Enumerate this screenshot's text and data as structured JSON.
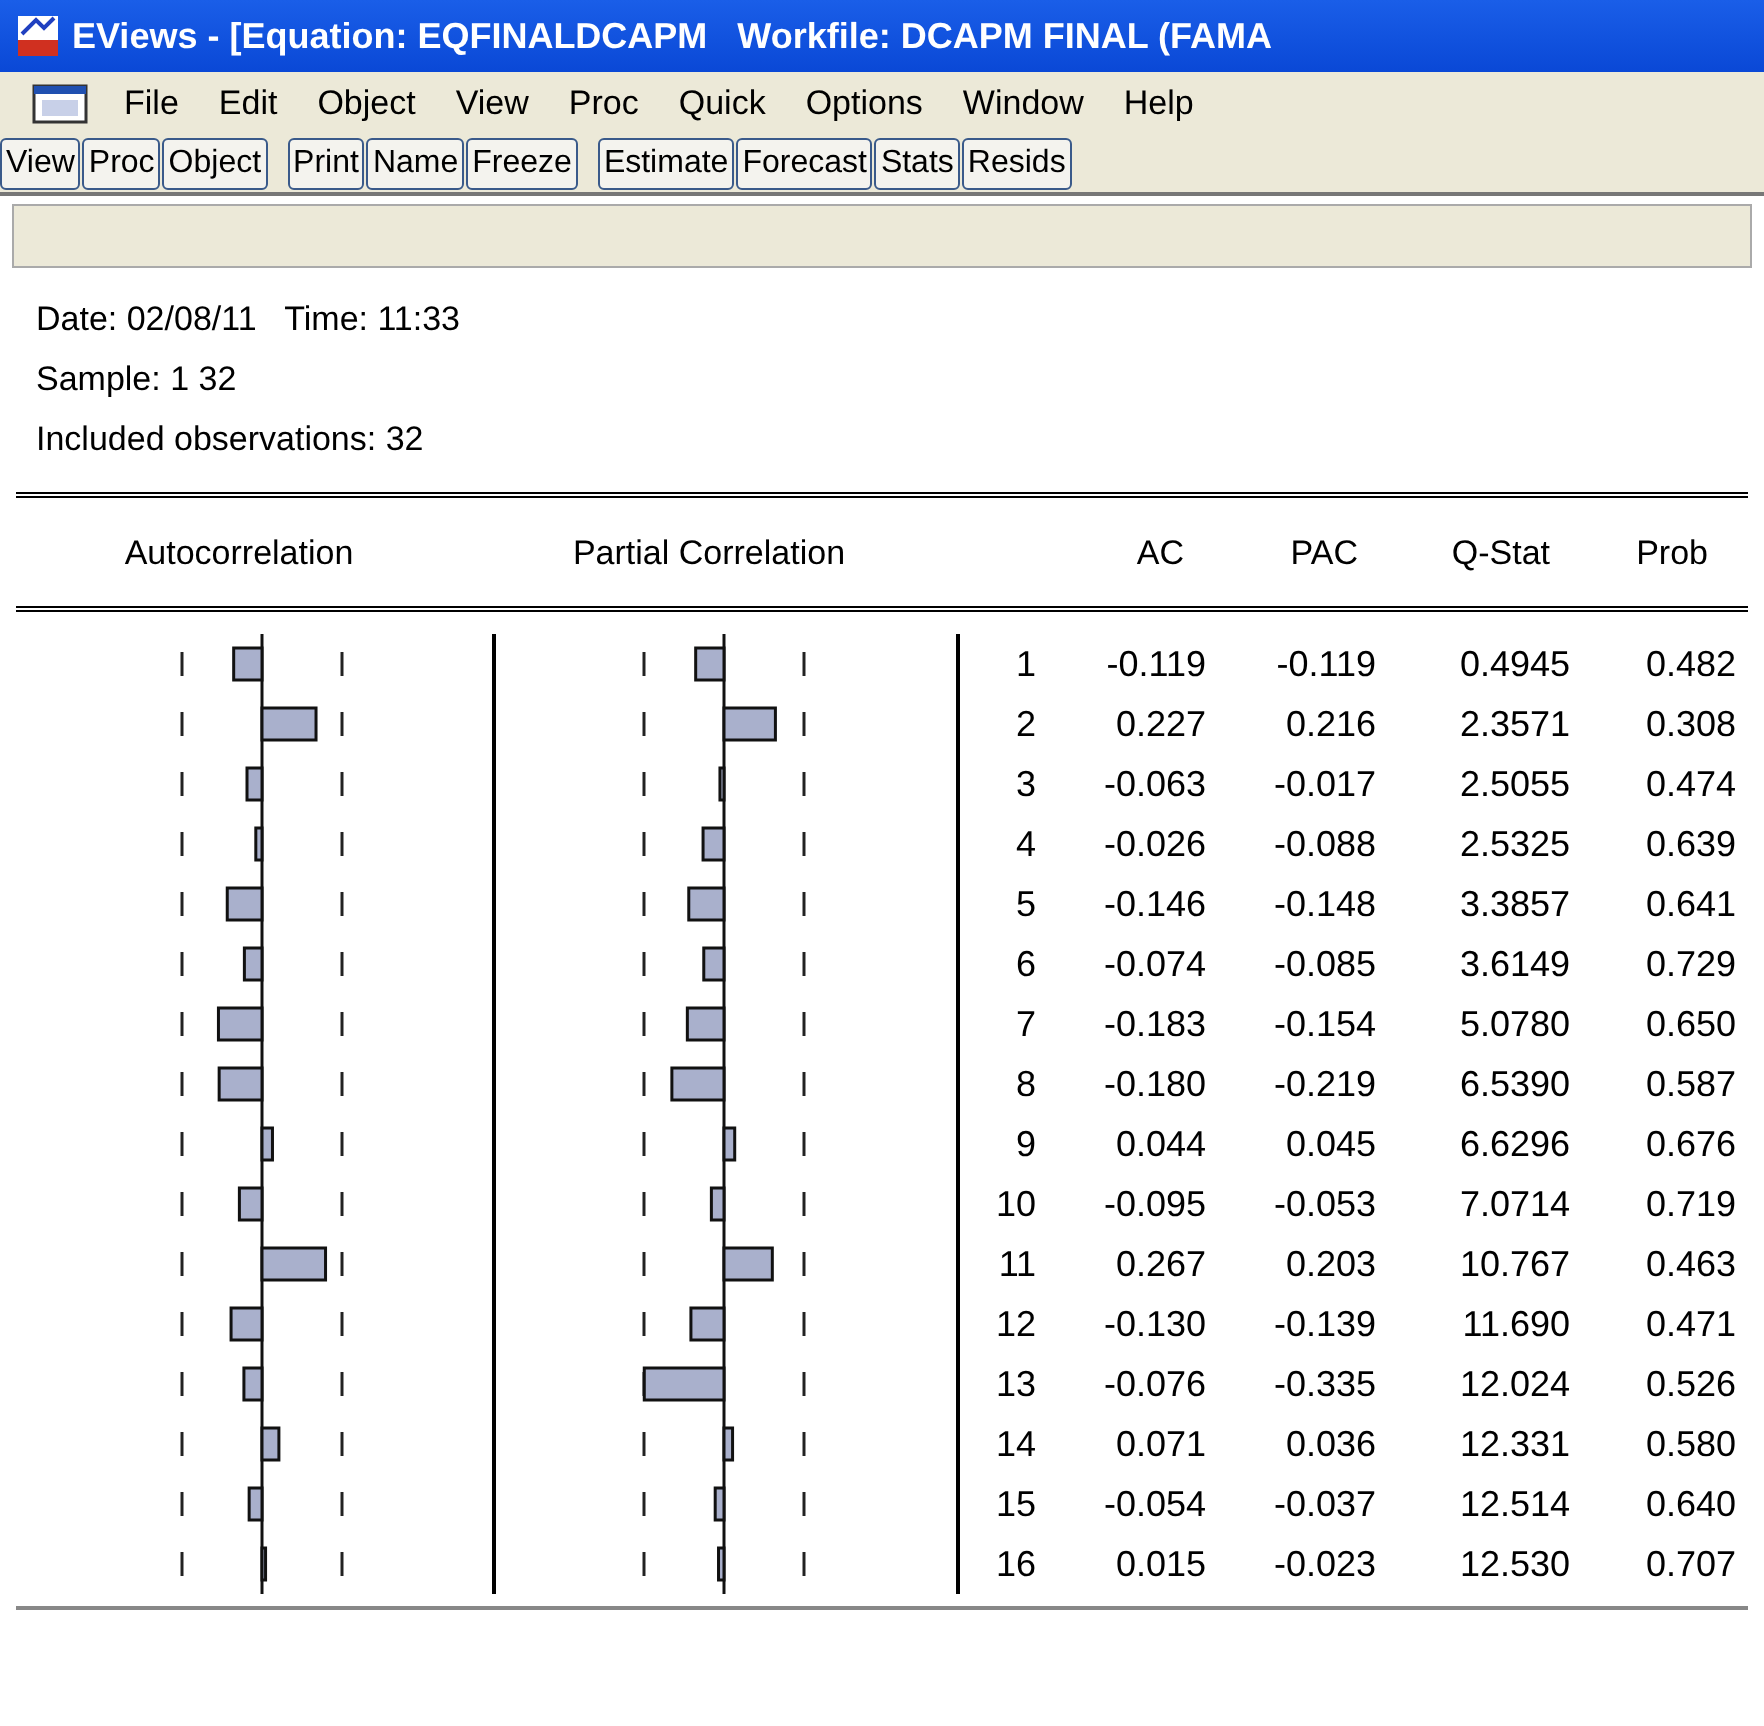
{
  "window": {
    "title": "EViews - [Equation: EQFINALDCAPM   Workfile: DCAPM FINAL (FAMA"
  },
  "menu": [
    "File",
    "Edit",
    "Object",
    "View",
    "Proc",
    "Quick",
    "Options",
    "Window",
    "Help"
  ],
  "toolbar": [
    [
      "View",
      "Proc",
      "Object"
    ],
    [
      "Print",
      "Name",
      "Freeze"
    ],
    [
      "Estimate",
      "Forecast",
      "Stats",
      "Resids"
    ]
  ],
  "header_lines": [
    "Date: 02/08/11   Time: 11:33",
    "Sample: 1 32",
    "Included observations: 32"
  ],
  "table": {
    "columns": [
      "Autocorrelation",
      "Partial Correlation",
      "AC",
      "PAC",
      "Q-Stat",
      "Prob"
    ],
    "rows": [
      {
        "lag": "1",
        "ac": "-0.119",
        "pac": "-0.119",
        "q_stat": "0.4945",
        "prob": "0.482"
      },
      {
        "lag": "2",
        "ac": "0.227",
        "pac": "0.216",
        "q_stat": "2.3571",
        "prob": "0.308"
      },
      {
        "lag": "3",
        "ac": "-0.063",
        "pac": "-0.017",
        "q_stat": "2.5055",
        "prob": "0.474"
      },
      {
        "lag": "4",
        "ac": "-0.026",
        "pac": "-0.088",
        "q_stat": "2.5325",
        "prob": "0.639"
      },
      {
        "lag": "5",
        "ac": "-0.146",
        "pac": "-0.148",
        "q_stat": "3.3857",
        "prob": "0.641"
      },
      {
        "lag": "6",
        "ac": "-0.074",
        "pac": "-0.085",
        "q_stat": "3.6149",
        "prob": "0.729"
      },
      {
        "lag": "7",
        "ac": "-0.183",
        "pac": "-0.154",
        "q_stat": "5.0780",
        "prob": "0.650"
      },
      {
        "lag": "8",
        "ac": "-0.180",
        "pac": "-0.219",
        "q_stat": "6.5390",
        "prob": "0.587"
      },
      {
        "lag": "9",
        "ac": "0.044",
        "pac": "0.045",
        "q_stat": "6.6296",
        "prob": "0.676"
      },
      {
        "lag": "10",
        "ac": "-0.095",
        "pac": "-0.053",
        "q_stat": "7.0714",
        "prob": "0.719"
      },
      {
        "lag": "11",
        "ac": "0.267",
        "pac": "0.203",
        "q_stat": "10.767",
        "prob": "0.463"
      },
      {
        "lag": "12",
        "ac": "-0.130",
        "pac": "-0.139",
        "q_stat": "11.690",
        "prob": "0.471"
      },
      {
        "lag": "13",
        "ac": "-0.076",
        "pac": "-0.335",
        "q_stat": "12.024",
        "prob": "0.526"
      },
      {
        "lag": "14",
        "ac": "0.071",
        "pac": "0.036",
        "q_stat": "12.331",
        "prob": "0.580"
      },
      {
        "lag": "15",
        "ac": "-0.054",
        "pac": "-0.037",
        "q_stat": "12.514",
        "prob": "0.640"
      },
      {
        "lag": "16",
        "ac": "0.015",
        "pac": "-0.023",
        "q_stat": "12.530",
        "prob": "0.707"
      }
    ]
  }
}
